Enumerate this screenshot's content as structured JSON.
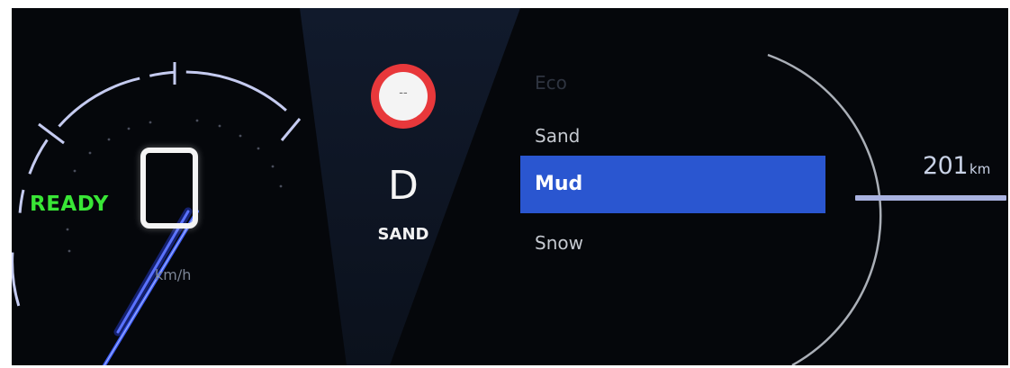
{
  "speedometer": {
    "status": "READY",
    "speed_value": "",
    "unit": "km/h"
  },
  "alert": {
    "text": "--",
    "icon": "warning-circle-icon"
  },
  "drive": {
    "gear": "D",
    "mode": "SAND"
  },
  "terrain_menu": {
    "items": [
      {
        "label": "Eco",
        "state": "faded"
      },
      {
        "label": "Sand",
        "state": "normal"
      },
      {
        "label": "Mud",
        "state": "selected"
      },
      {
        "label": "Snow",
        "state": "normal"
      }
    ]
  },
  "range": {
    "value": "201",
    "unit": "km"
  },
  "colors": {
    "ready_green": "#39e636",
    "selected_blue": "#2a56d0",
    "alert_red": "#e8383b",
    "gauge_blue": "#4f66ff"
  }
}
